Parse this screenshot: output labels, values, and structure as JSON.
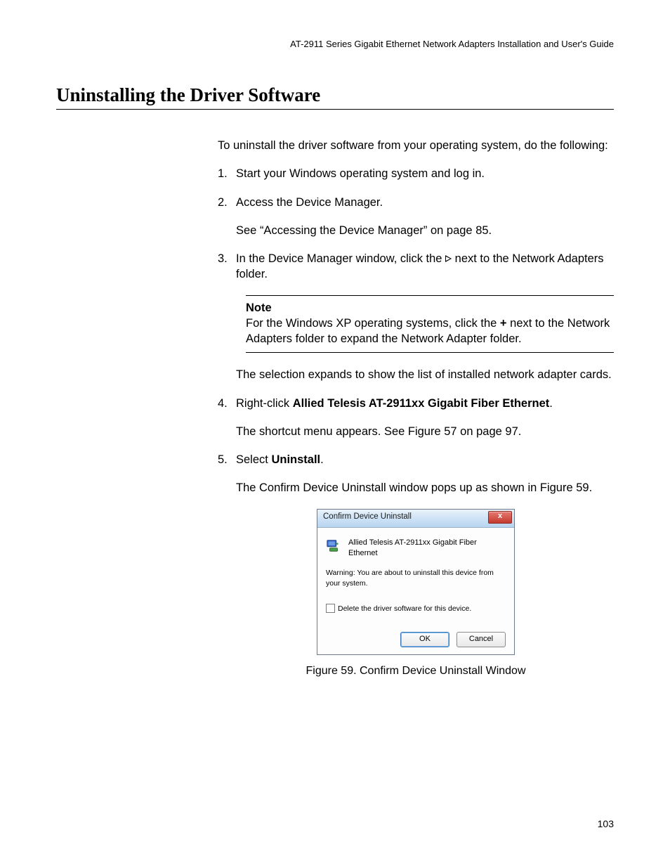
{
  "header": {
    "running_title": "AT-2911 Series Gigabit Ethernet Network Adapters Installation and User's Guide"
  },
  "section": {
    "title": "Uninstalling the Driver Software"
  },
  "intro": "To uninstall the driver software from your operating system, do the following:",
  "steps": {
    "s1": {
      "num": "1.",
      "text": "Start your Windows operating system and log in."
    },
    "s2": {
      "num": "2.",
      "text": "Access the Device Manager.",
      "sub": "See “Accessing the Device Manager” on page 85."
    },
    "s3": {
      "num": "3.",
      "pre": "In the Device Manager window, click the ",
      "post": " next to the Network Adapters folder.",
      "note_label": "Note",
      "note_pre": "For the Windows XP operating systems, click the ",
      "note_bold": "+",
      "note_post": " next to the Network Adapters folder to expand the Network Adapter folder.",
      "after": "The selection expands to show the list of installed network adapter cards."
    },
    "s4": {
      "num": "4.",
      "pre": "Right-click ",
      "bold": "Allied Telesis AT-2911xx Gigabit Fiber Ethernet",
      "post": ".",
      "sub": "The shortcut menu appears. See Figure 57 on page 97."
    },
    "s5": {
      "num": "5.",
      "pre": "Select ",
      "bold": "Uninstall",
      "post": ".",
      "sub": "The Confirm Device Uninstall window pops up as shown in Figure 59."
    }
  },
  "dialog": {
    "title": "Confirm Device Uninstall",
    "close_glyph": "x",
    "device_name": "Allied Telesis AT-2911xx Gigabit Fiber Ethernet",
    "warning": "Warning: You are about to uninstall this device from your system.",
    "checkbox_label": "Delete the driver software for this device.",
    "ok": "OK",
    "cancel": "Cancel"
  },
  "figure_caption": "Figure 59. Confirm Device Uninstall Window",
  "page_number": "103"
}
